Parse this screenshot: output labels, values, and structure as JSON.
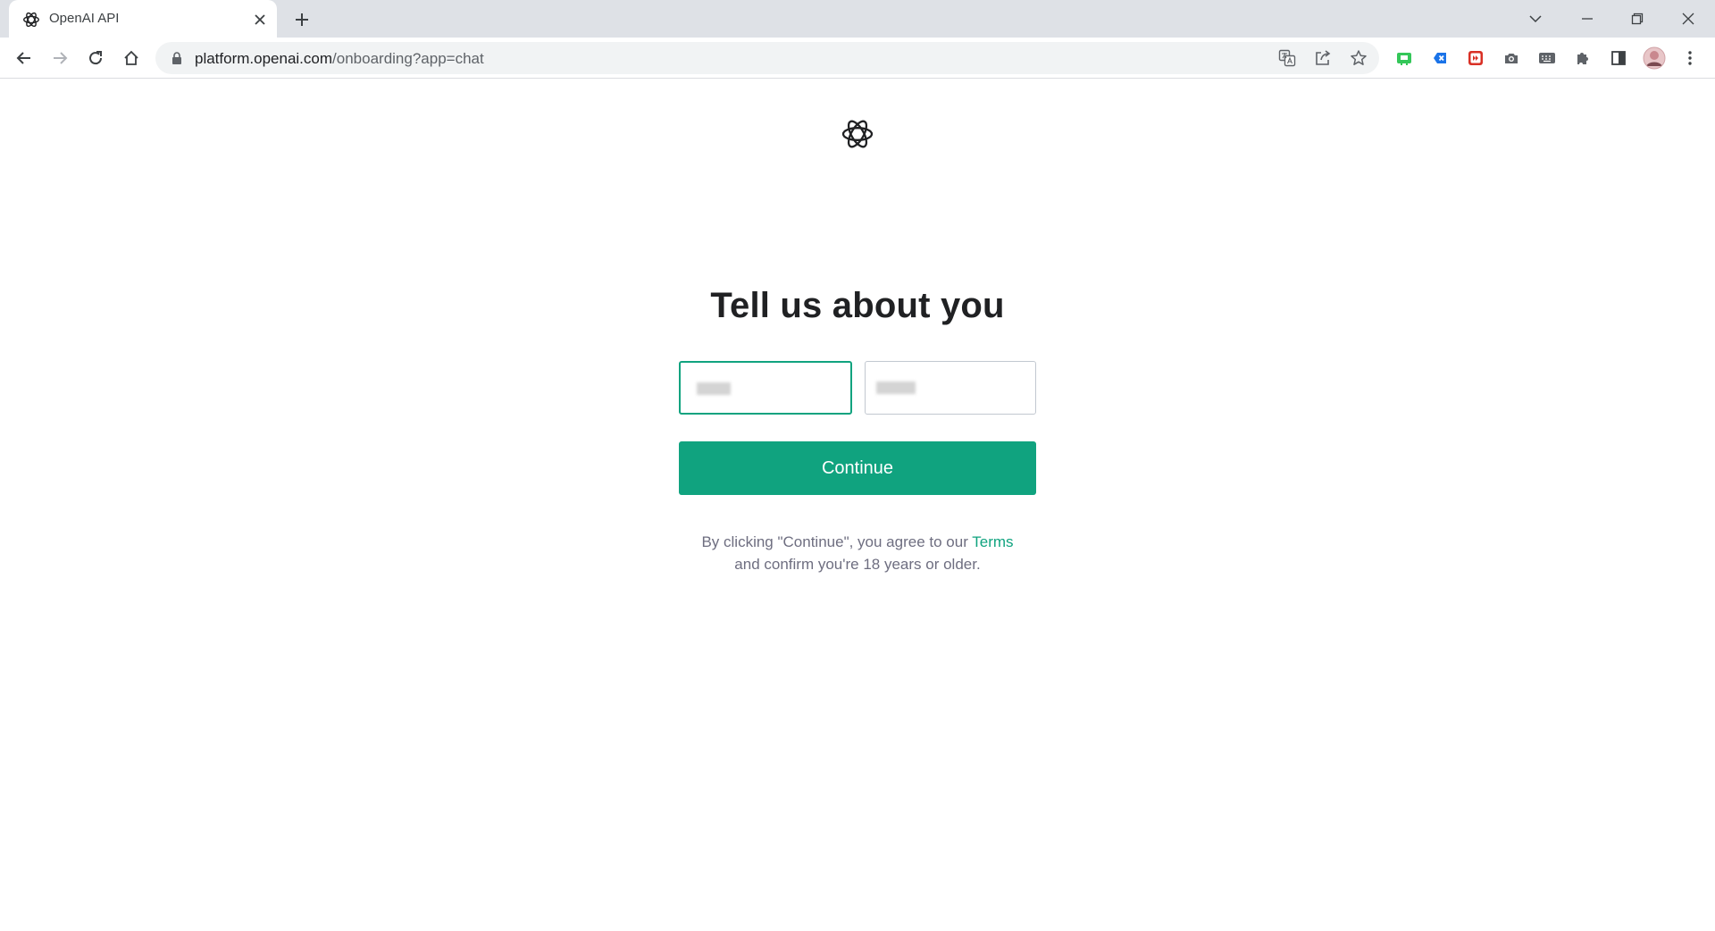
{
  "browser": {
    "tab": {
      "title": "OpenAI API",
      "favicon": "openai-logo-icon",
      "close_icon": "close-icon"
    },
    "new_tab_icon": "plus-icon",
    "window_controls": [
      "chevron-down-icon",
      "minimize-icon",
      "restore-icon",
      "close-icon"
    ],
    "nav": [
      "back-icon",
      "forward-icon",
      "reload-icon",
      "home-icon"
    ],
    "address": {
      "lock_icon": "lock-icon",
      "host": "platform.openai.com",
      "path": "/onboarding?app=chat"
    },
    "omnibox_actions": [
      "translate-icon",
      "share-icon",
      "star-icon"
    ],
    "extensions": [
      "green-extension-icon",
      "blue-x-extension-icon",
      "red-extension-icon",
      "camera-icon",
      "keyboard-icon",
      "puzzle-icon",
      "side-panel-icon",
      "profile-avatar",
      "kebab-menu-icon"
    ]
  },
  "page": {
    "logo": "openai-logo-icon",
    "title": "Tell us about you",
    "first_name": {
      "value": "",
      "obscured": true
    },
    "last_name": {
      "value": "",
      "obscured": true
    },
    "continue_label": "Continue",
    "legal": {
      "line1_prefix": "By clicking \"Continue\", you agree to our ",
      "terms_link": "Terms",
      "line2": "and confirm you're 18 years or older."
    }
  },
  "colors": {
    "accent": "#10a37f",
    "title_text": "#202123",
    "legal_text": "#6e6e80",
    "tabstrip": "#dee1e6"
  }
}
